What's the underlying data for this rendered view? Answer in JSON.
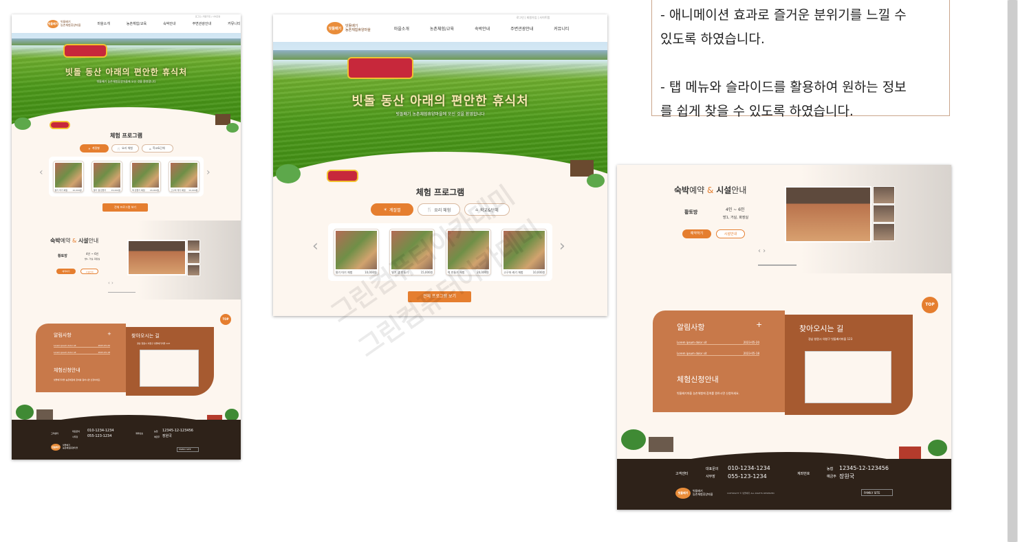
{
  "site": {
    "logo_mark": "빗돌배기",
    "logo_line1": "빗돌배기",
    "logo_line2": "농촌체험휴양마을",
    "menu": [
      "마을소개",
      "농촌체험/교육",
      "숙박안내",
      "주변관광안내",
      "커뮤니티"
    ],
    "util_links": "로그인 | 회원가입 | 사이트맵",
    "hero_title": "빗돌 동산 아래의 편안한 휴식처",
    "hero_sub": "빗돌배기 농촌체험휴양마을에 오신 것을 환영합니다"
  },
  "program": {
    "title": "체험 프로그램",
    "tabs": [
      "계절별",
      "요리 체험",
      "학교&단체"
    ],
    "cards": [
      {
        "name": "딸기 따기 체험",
        "price": "10,000원"
      },
      {
        "name": "딸기 잼 만들기",
        "price": "15,000원"
      },
      {
        "name": "떡 만들기 체험",
        "price": "20,000원"
      },
      {
        "name": "고구마 캐기 체험",
        "price": "10,000원"
      }
    ],
    "more_button": "전체 프로그램 보기"
  },
  "stay": {
    "title_bold1": "숙박",
    "title_light1": "예약",
    "title_amp": "&",
    "title_bold2": "시설",
    "title_light2": "안내",
    "room_name": "황토방",
    "room_capacity": "4인 ~ 6인",
    "room_features": "방1, 거실, 화장실",
    "reserve_button": "예약하기",
    "facility_button": "시설안내"
  },
  "notice": {
    "title": "알림사항",
    "plus": "+",
    "items": [
      {
        "text": "Lorem ipsum dolor sit",
        "date": "2023-05-20"
      },
      {
        "text": "Lorem ipsum dolor sit",
        "date": "2023-05-18"
      }
    ],
    "apply_title": "체험신청안내",
    "apply_text": "빗돌배기마을 농촌체험에 참여를 원하시면 신청하세요."
  },
  "directions": {
    "title": "찾아오시는 길",
    "address": "경남 창원시 의창구 빗돌배기마을 123"
  },
  "top_button": "TOP",
  "footer": {
    "phone_label1": "대표문의",
    "phone_label2": "사무장",
    "phone1": "010-1234-1234",
    "phone2": "055-123-1234",
    "col_label": "고객센터",
    "account_label": "계좌번호",
    "bank_label1": "농협",
    "bank_label2": "예금주",
    "account": "12345-12-123456",
    "holder": "장원국",
    "family_site": "FAMILY SITE",
    "copyright": "COPYRIGHT © 빗돌배기 ALL RIGHTS RESERVED"
  },
  "description": {
    "line_partial": "- 애니메이션 효과로 즐거운 분위기를 느낄 수",
    "line2": "있도록 하였습니다.",
    "line3": "- 탭 메뉴와 슬라이드를 활용하여 원하는 정보",
    "line4": "를 쉽게 찾을 수 있도록 하였습니다."
  },
  "watermark": "그린컴퓨터아카데미"
}
